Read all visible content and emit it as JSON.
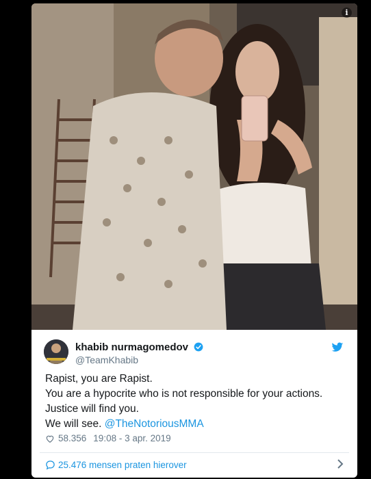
{
  "tweet": {
    "display_name": "khabib nurmagomedov",
    "handle": "@TeamKhabib",
    "lines": [
      "Rapist, you are Rapist.",
      "You are a hypocrite who is not responsible for your actions.",
      "Justice will find you.",
      "We will see. "
    ],
    "mention": "@TheNotoriousMMA",
    "likes": "58.356",
    "timestamp": "19:08 - 3 apr. 2019",
    "replies_link": "25.476 mensen praten hierover",
    "info_icon": "i"
  },
  "icons": {
    "info": "info-icon",
    "verified": "verified-badge-icon",
    "bird": "twitter-bird-icon",
    "like": "heart-icon",
    "reply": "speech-bubble-icon",
    "chevron": "chevron-right-icon"
  },
  "colors": {
    "link": "#1b95e0",
    "verified": "#1da1f2",
    "text": "#14171a",
    "muted": "#657786"
  }
}
